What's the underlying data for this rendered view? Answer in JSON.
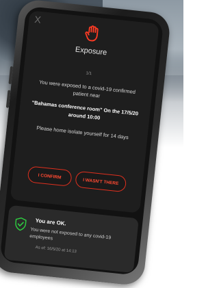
{
  "dialog": {
    "close": "X",
    "title": "Exposure",
    "pager": "1/1",
    "message": "You were exposed to a covid-19 confirmed patient near",
    "location": "\"Bahamas conference room\" On the 17/5/20 around 10:00",
    "instruction": "Please home isolate yourself for 14 days",
    "confirm_label": "I CONFIRM",
    "not_there_label": "I WASN'T THERE"
  },
  "status": {
    "heading": "You are OK.",
    "detail": "You were not exposed to any covid-19 employees",
    "as_of": "As of: 16/5/20 at 14:13"
  },
  "colors": {
    "accent": "#e0301e",
    "ok_green": "#2ecc40",
    "card": "#1e1e1e"
  },
  "icons": [
    "close-icon",
    "hand-stop-icon",
    "shield-check-icon"
  ]
}
